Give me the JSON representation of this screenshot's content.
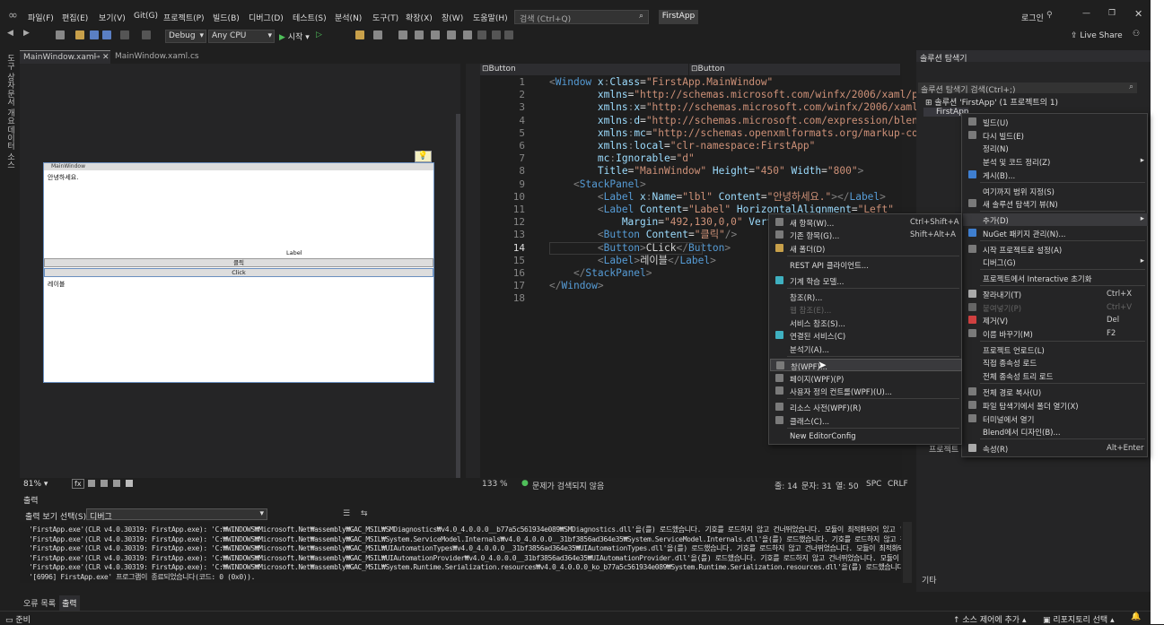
{
  "menubar": {
    "items": [
      "파일(F)",
      "편집(E)",
      "보기(V)",
      "Git(G)",
      "프로젝트(P)",
      "빌드(B)",
      "디버그(D)",
      "테스트(S)",
      "분석(N)",
      "도구(T)",
      "확장(X)",
      "창(W)",
      "도움말(H)"
    ],
    "search_placeholder": "검색 (Ctrl+Q)",
    "app_name": "FirstApp",
    "login": "로그인"
  },
  "toolbar": {
    "config": "Debug",
    "platform": "Any CPU",
    "start": "시작",
    "live_share": "Live Share"
  },
  "left_strip": [
    "도구 상자",
    "문서 개요",
    "데이터 소스"
  ],
  "doc_tabs": {
    "tab1": "MainWindow.xaml",
    "tab2": "MainWindow.xaml.cs"
  },
  "designer": {
    "window_title": "MainWindow",
    "label1": "안녕하세요.",
    "label2": "Label",
    "button1": "클릭",
    "button2": "Click",
    "label3": "레이블",
    "zoom": "81%"
  },
  "editor": {
    "left_dropdown": "Button",
    "right_dropdown": "Button",
    "lines": [
      [
        [
          "<",
          "#808080"
        ],
        [
          "Window ",
          "#569cd6"
        ],
        [
          "x",
          "#9cdcfe"
        ],
        [
          ":",
          "#808080"
        ],
        [
          "Class",
          "#9cdcfe"
        ],
        [
          "=",
          "#d4d4d4"
        ],
        [
          "\"FirstApp.MainWindow\"",
          "#ce9178"
        ]
      ],
      [
        [
          "        xmlns",
          "#9cdcfe"
        ],
        [
          "=",
          "#d4d4d4"
        ],
        [
          "\"http://schemas.microsoft.com/winfx/2006/xaml/presentati",
          "#ce9178"
        ]
      ],
      [
        [
          "        xmlns",
          "#9cdcfe"
        ],
        [
          ":",
          "#808080"
        ],
        [
          "x",
          "#9cdcfe"
        ],
        [
          "=",
          "#d4d4d4"
        ],
        [
          "\"http://schemas.microsoft.com/winfx/2006/xaml\"",
          "#ce9178"
        ]
      ],
      [
        [
          "        xmlns",
          "#9cdcfe"
        ],
        [
          ":",
          "#808080"
        ],
        [
          "d",
          "#9cdcfe"
        ],
        [
          "=",
          "#d4d4d4"
        ],
        [
          "\"http://schemas.microsoft.com/expression/blend/2008\"",
          "#ce9178"
        ]
      ],
      [
        [
          "        xmlns",
          "#9cdcfe"
        ],
        [
          ":",
          "#808080"
        ],
        [
          "mc",
          "#9cdcfe"
        ],
        [
          "=",
          "#d4d4d4"
        ],
        [
          "\"http://schemas.openxmlformats.org/markup-compatibi",
          "#ce9178"
        ]
      ],
      [
        [
          "        xmlns",
          "#9cdcfe"
        ],
        [
          ":",
          "#808080"
        ],
        [
          "local",
          "#9cdcfe"
        ],
        [
          "=",
          "#d4d4d4"
        ],
        [
          "\"clr-namespace:FirstApp\"",
          "#ce9178"
        ]
      ],
      [
        [
          "        mc",
          "#9cdcfe"
        ],
        [
          ":",
          "#808080"
        ],
        [
          "Ignorable",
          "#9cdcfe"
        ],
        [
          "=",
          "#d4d4d4"
        ],
        [
          "\"d\"",
          "#ce9178"
        ]
      ],
      [
        [
          "        Title",
          "#9cdcfe"
        ],
        [
          "=",
          "#d4d4d4"
        ],
        [
          "\"MainWindow\" ",
          "#ce9178"
        ],
        [
          "Height",
          "#9cdcfe"
        ],
        [
          "=",
          "#d4d4d4"
        ],
        [
          "\"450\" ",
          "#ce9178"
        ],
        [
          "Width",
          "#9cdcfe"
        ],
        [
          "=",
          "#d4d4d4"
        ],
        [
          "\"800\"",
          "#ce9178"
        ],
        [
          ">",
          "#808080"
        ]
      ],
      [
        [
          "    <",
          "#808080"
        ],
        [
          "StackPanel",
          "#569cd6"
        ],
        [
          ">",
          "#808080"
        ]
      ],
      [
        [
          "        <",
          "#808080"
        ],
        [
          "Label ",
          "#569cd6"
        ],
        [
          "x",
          "#9cdcfe"
        ],
        [
          ":",
          "#808080"
        ],
        [
          "Name",
          "#9cdcfe"
        ],
        [
          "=",
          "#d4d4d4"
        ],
        [
          "\"lbl\" ",
          "#ce9178"
        ],
        [
          "Content",
          "#9cdcfe"
        ],
        [
          "=",
          "#d4d4d4"
        ],
        [
          "\"안녕하세요.\"",
          "#ce9178"
        ],
        [
          "></",
          "#808080"
        ],
        [
          "Label",
          "#569cd6"
        ],
        [
          ">",
          "#808080"
        ]
      ],
      [
        [
          "        <",
          "#808080"
        ],
        [
          "Label ",
          "#569cd6"
        ],
        [
          "Content",
          "#9cdcfe"
        ],
        [
          "=",
          "#d4d4d4"
        ],
        [
          "\"Label\" ",
          "#ce9178"
        ],
        [
          "HorizontalAlignment",
          "#9cdcfe"
        ],
        [
          "=",
          "#d4d4d4"
        ],
        [
          "\"Left\"",
          "#ce9178"
        ]
      ],
      [
        [
          "            Margin",
          "#9cdcfe"
        ],
        [
          "=",
          "#d4d4d4"
        ],
        [
          "\"492,130,0,0\" ",
          "#ce9178"
        ],
        [
          "VerticalAlig",
          "#9cdcfe"
        ]
      ],
      [
        [
          "        <",
          "#808080"
        ],
        [
          "Button ",
          "#569cd6"
        ],
        [
          "Content",
          "#9cdcfe"
        ],
        [
          "=",
          "#d4d4d4"
        ],
        [
          "\"클릭\"",
          "#ce9178"
        ],
        [
          "/>",
          "#808080"
        ]
      ],
      [
        [
          "        <",
          "#808080"
        ],
        [
          "Button",
          "#569cd6"
        ],
        [
          ">",
          "#808080"
        ],
        [
          "CLick",
          "#d4d4d4"
        ],
        [
          "</",
          "#808080"
        ],
        [
          "Button",
          "#569cd6"
        ],
        [
          ">",
          "#808080"
        ]
      ],
      [
        [
          "        <",
          "#808080"
        ],
        [
          "Label",
          "#569cd6"
        ],
        [
          ">",
          "#808080"
        ],
        [
          "레이블",
          "#d4d4d4"
        ],
        [
          "</",
          "#808080"
        ],
        [
          "Label",
          "#569cd6"
        ],
        [
          ">",
          "#808080"
        ]
      ],
      [
        [
          "    </",
          "#808080"
        ],
        [
          "StackPanel",
          "#569cd6"
        ],
        [
          ">",
          "#808080"
        ]
      ],
      [
        [
          "</",
          "#808080"
        ],
        [
          "Window",
          "#569cd6"
        ],
        [
          ">",
          "#808080"
        ]
      ],
      [
        [
          "",
          "#d4d4d4"
        ]
      ]
    ],
    "status": {
      "zoom": "133 %",
      "issues": "문제가 검색되지 않음",
      "line": "줄: 14",
      "char": "문자: 31",
      "col": "열: 50",
      "spc": "SPC",
      "crlf": "CRLF"
    }
  },
  "add_submenu": [
    {
      "label": "새 항목(W)...",
      "shortcut": "Ctrl+Shift+A"
    },
    {
      "label": "기존 항목(G)...",
      "shortcut": "Shift+Alt+A"
    },
    {
      "label": "새 폴더(D)",
      "shortcut": ""
    },
    {
      "label": "REST API 클라이언트...",
      "shortcut": ""
    },
    {
      "label": "기계 학습 모델...",
      "shortcut": ""
    },
    {
      "label": "참조(R)...",
      "shortcut": ""
    },
    {
      "label": "웹 참조(E)...",
      "shortcut": ""
    },
    {
      "label": "서비스 참조(S)...",
      "shortcut": ""
    },
    {
      "label": "연결된 서비스(C)",
      "shortcut": ""
    },
    {
      "label": "분석기(A)...",
      "shortcut": ""
    },
    {
      "label": "창(WPF)...",
      "shortcut": ""
    },
    {
      "label": "페이지(WPF)(P)",
      "shortcut": ""
    },
    {
      "label": "사용자 정의 컨트롤(WPF)(U)...",
      "shortcut": ""
    },
    {
      "label": "리소스 사전(WPF)(R)",
      "shortcut": ""
    },
    {
      "label": "클래스(C)...",
      "shortcut": ""
    },
    {
      "label": "New EditorConfig",
      "shortcut": ""
    }
  ],
  "project_menu": [
    {
      "label": "빌드(U)",
      "shortcut": ""
    },
    {
      "label": "다시 빌드(E)",
      "shortcut": ""
    },
    {
      "label": "정리(N)",
      "shortcut": ""
    },
    {
      "label": "분석 및 코드 정리(Z)",
      "shortcut": ""
    },
    {
      "label": "게시(B)...",
      "shortcut": ""
    },
    {
      "label": "여기까지 범위 지정(S)",
      "shortcut": ""
    },
    {
      "label": "새 솔루션 탐색기 뷰(N)",
      "shortcut": ""
    },
    {
      "label": "추가(D)",
      "shortcut": ""
    },
    {
      "label": "NuGet 패키지 관리(N)...",
      "shortcut": ""
    },
    {
      "label": "시작 프로젝트로 설정(A)",
      "shortcut": ""
    },
    {
      "label": "디버그(G)",
      "shortcut": ""
    },
    {
      "label": "프로젝트에서 Interactive 초기화",
      "shortcut": ""
    },
    {
      "label": "잘라내기(T)",
      "shortcut": "Ctrl+X"
    },
    {
      "label": "붙여넣기(P)",
      "shortcut": "Ctrl+V"
    },
    {
      "label": "제거(V)",
      "shortcut": "Del"
    },
    {
      "label": "이름 바꾸기(M)",
      "shortcut": "F2"
    },
    {
      "label": "프로젝트 언로드(L)",
      "shortcut": ""
    },
    {
      "label": "직접 종속성 로드",
      "shortcut": ""
    },
    {
      "label": "전체 종속성 트리 로드",
      "shortcut": ""
    },
    {
      "label": "전체 경로 복사(U)",
      "shortcut": ""
    },
    {
      "label": "파일 탐색기에서 폴더 열기(X)",
      "shortcut": ""
    },
    {
      "label": "터미널에서 열기",
      "shortcut": ""
    },
    {
      "label": "Blend에서 디자인(B)...",
      "shortcut": ""
    },
    {
      "label": "속성(R)",
      "shortcut": "Alt+Enter"
    }
  ],
  "solution_explorer": {
    "title": "솔루션 탐색기",
    "search": "솔루션 탐색기 검색(Ctrl+;)",
    "solution": "솔루션 'FirstApp' (1 프로젝트의 1)",
    "project": "FirstApp",
    "properties_label": "프로젝트",
    "misc": "기타"
  },
  "output": {
    "title": "출력",
    "source_label": "출력 보기 선택(S):",
    "source": "디버그",
    "lines": [
      "'FirstApp.exe'(CLR v4.0.30319: FirstApp.exe): 'C:₩WINDOWS₩Microsoft.Net₩assembly₩GAC_MSIL₩SMDiagnostics₩v4.0_4.0.0.0__b77a5c561934e089₩SMDiagnostics.dll'을(를) 로드했습니다. 기호를 로드하지 않고 건너뛰었습니다. 모듈이 최적화되어 있고 '내 코드만'",
      "'FirstApp.exe'(CLR v4.0.30319: FirstApp.exe): 'C:₩WINDOWS₩Microsoft.Net₩assembly₩GAC_MSIL₩System.ServiceModel.Internals₩v4.0_4.0.0.0__31bf3856ad364e35₩System.ServiceModel.Internals.dll'을(를) 로드했습니다. 기호를 로드하지 않고 건너뛰었습니다.",
      "'FirstApp.exe'(CLR v4.0.30319: FirstApp.exe): 'C:₩WINDOWS₩Microsoft.Net₩assembly₩GAC_MSIL₩UIAutomationTypes₩v4.0_4.0.0.0__31bf3856ad364e35₩UIAutomationTypes.dll'을(를) 로드했습니다. 기호를 로드하지 않고 건너뛰었습니다. 모듈이 최적화되어 있고 '",
      "'FirstApp.exe'(CLR v4.0.30319: FirstApp.exe): 'C:₩WINDOWS₩Microsoft.Net₩assembly₩GAC_MSIL₩UIAutomationProvider₩v4.0_4.0.0.0__31bf3856ad364e35₩UIAutomationProvider.dll'을(를) 로드했습니다. 기호를 로드하지 않고 건너뛰었습니다. 모듈이 최적화되어",
      "'FirstApp.exe'(CLR v4.0.30319: FirstApp.exe): 'C:₩WINDOWS₩Microsoft.Net₩assembly₩GAC_MSIL₩System.Runtime.Serialization.resources₩v4.0_4.0.0.0_ko_b77a5c561934e089₩System.Runtime.Serialization.resources.dll'을(를) 로드했습니다. 모듈이 기호 없이",
      "'[6996] FirstApp.exe' 프로그램이 종료되었습니다(코드: 0 (0x0))."
    ],
    "tab_errors": "오류 목록",
    "tab_output": "출력"
  },
  "statusbar": {
    "ready": "준비",
    "source_control": "소스 제어에 추가",
    "repo": "리포지토리 선택"
  }
}
